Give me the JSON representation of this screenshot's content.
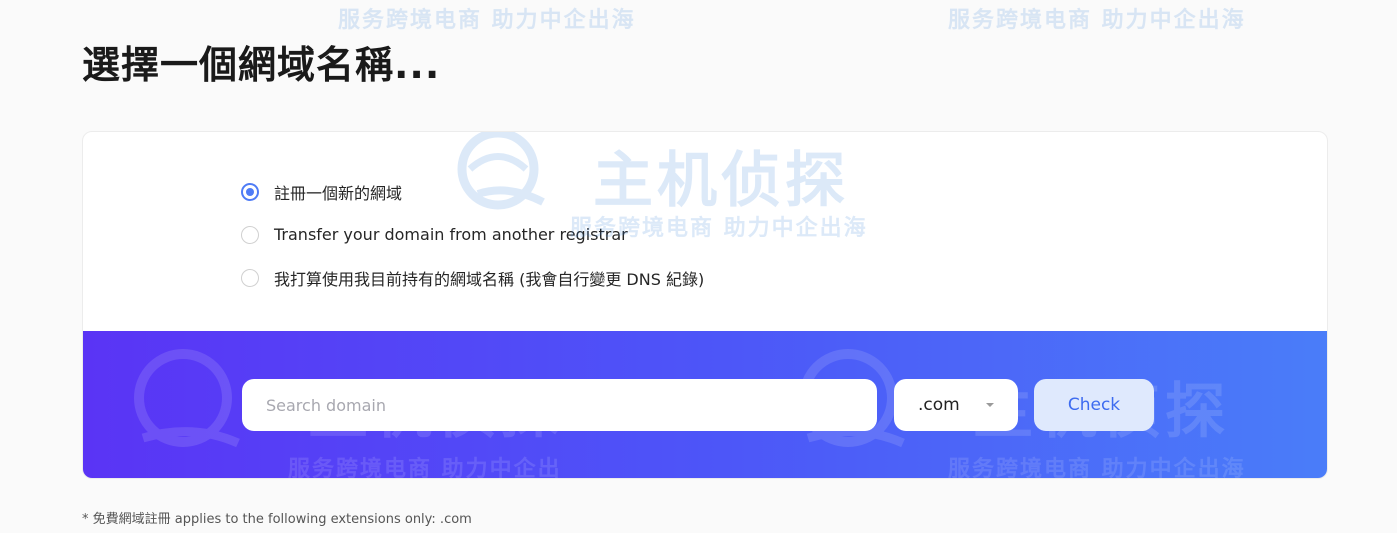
{
  "page": {
    "title": "選擇一個網域名稱..."
  },
  "options": [
    {
      "label": "註冊一個新的網域",
      "selected": true
    },
    {
      "label": "Transfer your domain from another registrar",
      "selected": false
    },
    {
      "label": "我打算使用我目前持有的網域名稱 (我會自行變更 DNS 紀錄)",
      "selected": false
    }
  ],
  "search": {
    "placeholder": "Search domain",
    "value": "",
    "tld_selected": ".com",
    "check_label": "Check"
  },
  "footnote": "* 免費網域註冊 applies to the following extensions only: .com",
  "watermark": {
    "logo": "主机侦探",
    "slogan": "服务跨境电商  助力中企出海"
  },
  "colors": {
    "accent": "#4f7cf6",
    "band_start": "#5a34f5",
    "band_end": "#4a7df9",
    "check_bg": "#dfe9fd",
    "check_text": "#3d6bf0"
  },
  "icons": {
    "radio": "radio-circle",
    "dropdown": "caret-down-icon",
    "watermark": "globe-logo-icon"
  }
}
